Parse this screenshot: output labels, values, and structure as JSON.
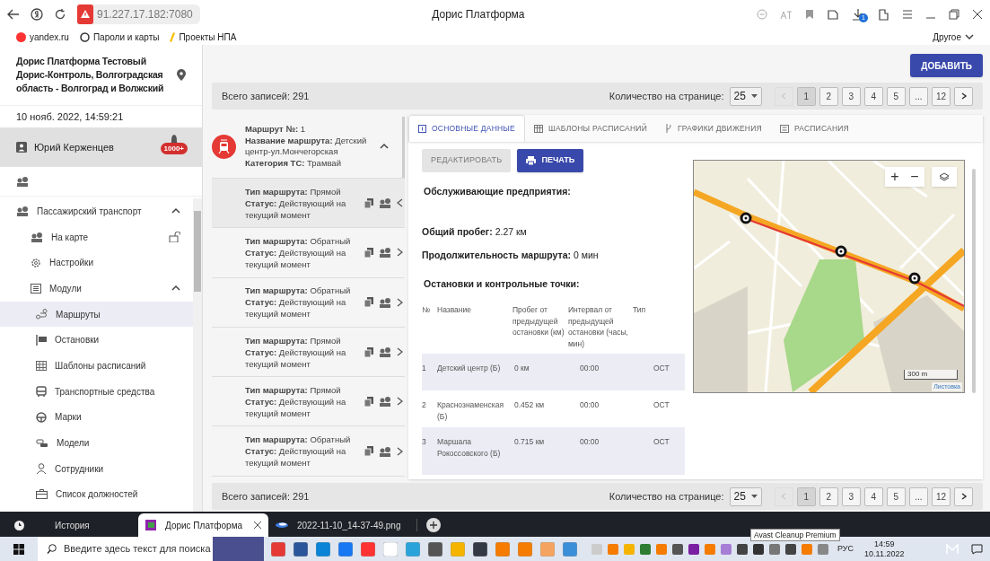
{
  "browser": {
    "address": "91.227.17.182:7080",
    "title": "Дорис Платформа",
    "downloads_badge": "1",
    "bookmarks": [
      "yandex.ru",
      "Пароли и карты",
      "Проекты НПА"
    ],
    "other_bookmarks": "Другое"
  },
  "sidebar": {
    "organization": "Дорис Платформа Тестовый Дорис-Контроль, Волгоградская область - Волгоград и Волжский",
    "datetime": "10 нояб. 2022, 14:59:21",
    "user": "Юрий Керженцев",
    "notifications": "1000+",
    "menu": [
      {
        "label": "Пассажирский транспорт",
        "selected": false,
        "expanded": true,
        "children": [
          {
            "label": "На карте",
            "selected": false,
            "locked": false
          },
          {
            "label": "Настройки",
            "selected": false
          },
          {
            "label": "Модули",
            "selected": false,
            "expanded": true,
            "children": [
              {
                "label": "Маршруты",
                "selected": true
              },
              {
                "label": "Остановки",
                "selected": false
              },
              {
                "label": "Шаблоны расписаний",
                "selected": false
              },
              {
                "label": "Транспортные средства",
                "selected": false
              },
              {
                "label": "Марки",
                "selected": false
              },
              {
                "label": "Модели",
                "selected": false
              },
              {
                "label": "Сотрудники",
                "selected": false
              },
              {
                "label": "Список должностей",
                "selected": false
              }
            ]
          }
        ]
      }
    ]
  },
  "add_button": "ДОБАВИТЬ",
  "pagination_top": {
    "total": "Всего записей: 291",
    "per_page_label": "Количество на странице:",
    "per_page": "25",
    "pages": [
      {
        "label": "1",
        "selected": true
      },
      {
        "label": "2",
        "selected": false
      },
      {
        "label": "3",
        "selected": false
      },
      {
        "label": "4",
        "selected": false
      },
      {
        "label": "5",
        "selected": false
      },
      {
        "label": "...",
        "selected": false
      },
      {
        "label": "12",
        "selected": false
      }
    ]
  },
  "route": {
    "number": "**Маршрут №:** 1",
    "name": "**Название маршрута:** Детский центр-ул.Мончегорская",
    "category": "**Категория ТС:** Трамвай",
    "expanded": true,
    "variants": [
      {
        "type": "**Тип маршрута:** Прямой",
        "status": "**Статус:** Действующий на текущий момент",
        "selected": true
      },
      {
        "type": "**Тип маршрута:** Обратный",
        "status": "**Статус:** Действующий на текущий момент",
        "selected": false
      },
      {
        "type": "**Тип маршрута:** Обратный",
        "status": "**Статус:** Действующий на текущий момент",
        "selected": false
      },
      {
        "type": "**Тип маршрута:** Прямой",
        "status": "**Статус:** Действующий на текущий момент",
        "selected": false
      },
      {
        "type": "**Тип маршрута:** Прямой",
        "status": "**Статус:** Действующий на текущий момент",
        "selected": false
      },
      {
        "type": "**Тип маршрута:** Обратный",
        "status": "**Статус:** Действующий на текущий момент",
        "selected": false
      }
    ]
  },
  "tabs": [
    {
      "label": "ОСНОВНЫЕ ДАННЫЕ",
      "selected": true
    },
    {
      "label": "ШАБЛОНЫ РАСПИСАНИЙ",
      "selected": false
    },
    {
      "label": "ГРАФИКИ ДВИЖЕНИЯ",
      "selected": false
    },
    {
      "label": "РАСПИСАНИЯ",
      "selected": false
    }
  ],
  "details": {
    "edit_button": {
      "label": "РЕДАКТИРОВАТЬ",
      "disabled": true
    },
    "print_button": "ПЕЧАТЬ",
    "operators_heading": "Обслуживающие предприятия:",
    "mileage": "**Общий пробег:** 2.27 км",
    "duration": "**Продолжительность маршрута:** 0 мин",
    "stops_heading": "Остановки и контрольные точки:",
    "columns": [
      "№",
      "Название",
      "Пробег от предыдущей остановки (км)",
      "Интервал от предыдущей остановки (часы, мин)",
      "Тип"
    ],
    "rows": [
      [
        "1",
        "Детский центр (Б)",
        "0 км",
        "00:00",
        "ОСТ"
      ],
      [
        "2",
        "Краснознаменская (Б)",
        "0.452 км",
        "00:00",
        "ОСТ"
      ],
      [
        "3",
        "Маршала Рокоссовского (Б)",
        "0.715 км",
        "00:00",
        "ОСТ"
      ]
    ]
  },
  "map": {
    "zoom_in": "+",
    "zoom_out": "−",
    "scale": "300 m",
    "attribution": "Листовка"
  },
  "pagination_bottom": {
    "total": "Всего записей: 291",
    "per_page_label": "Количество на странице:",
    "per_page": "25",
    "pages": [
      {
        "label": "1",
        "selected": true
      },
      {
        "label": "2",
        "selected": false
      },
      {
        "label": "3",
        "selected": false
      },
      {
        "label": "4",
        "selected": false
      },
      {
        "label": "5",
        "selected": false
      },
      {
        "label": "...",
        "selected": false
      },
      {
        "label": "12",
        "selected": false
      }
    ]
  },
  "browser_tabs": [
    {
      "label": "История",
      "selected": false
    },
    {
      "label": "Дорис Платформа",
      "selected": true
    },
    {
      "label": "2022-11-10_14-37-49.png",
      "selected": false
    }
  ],
  "taskbar": {
    "search_placeholder": "Введите здесь текст для поиска",
    "tooltip": "Avast Cleanup Premium",
    "language": "РУС",
    "time": "14:59",
    "date": "10.11.2022"
  }
}
